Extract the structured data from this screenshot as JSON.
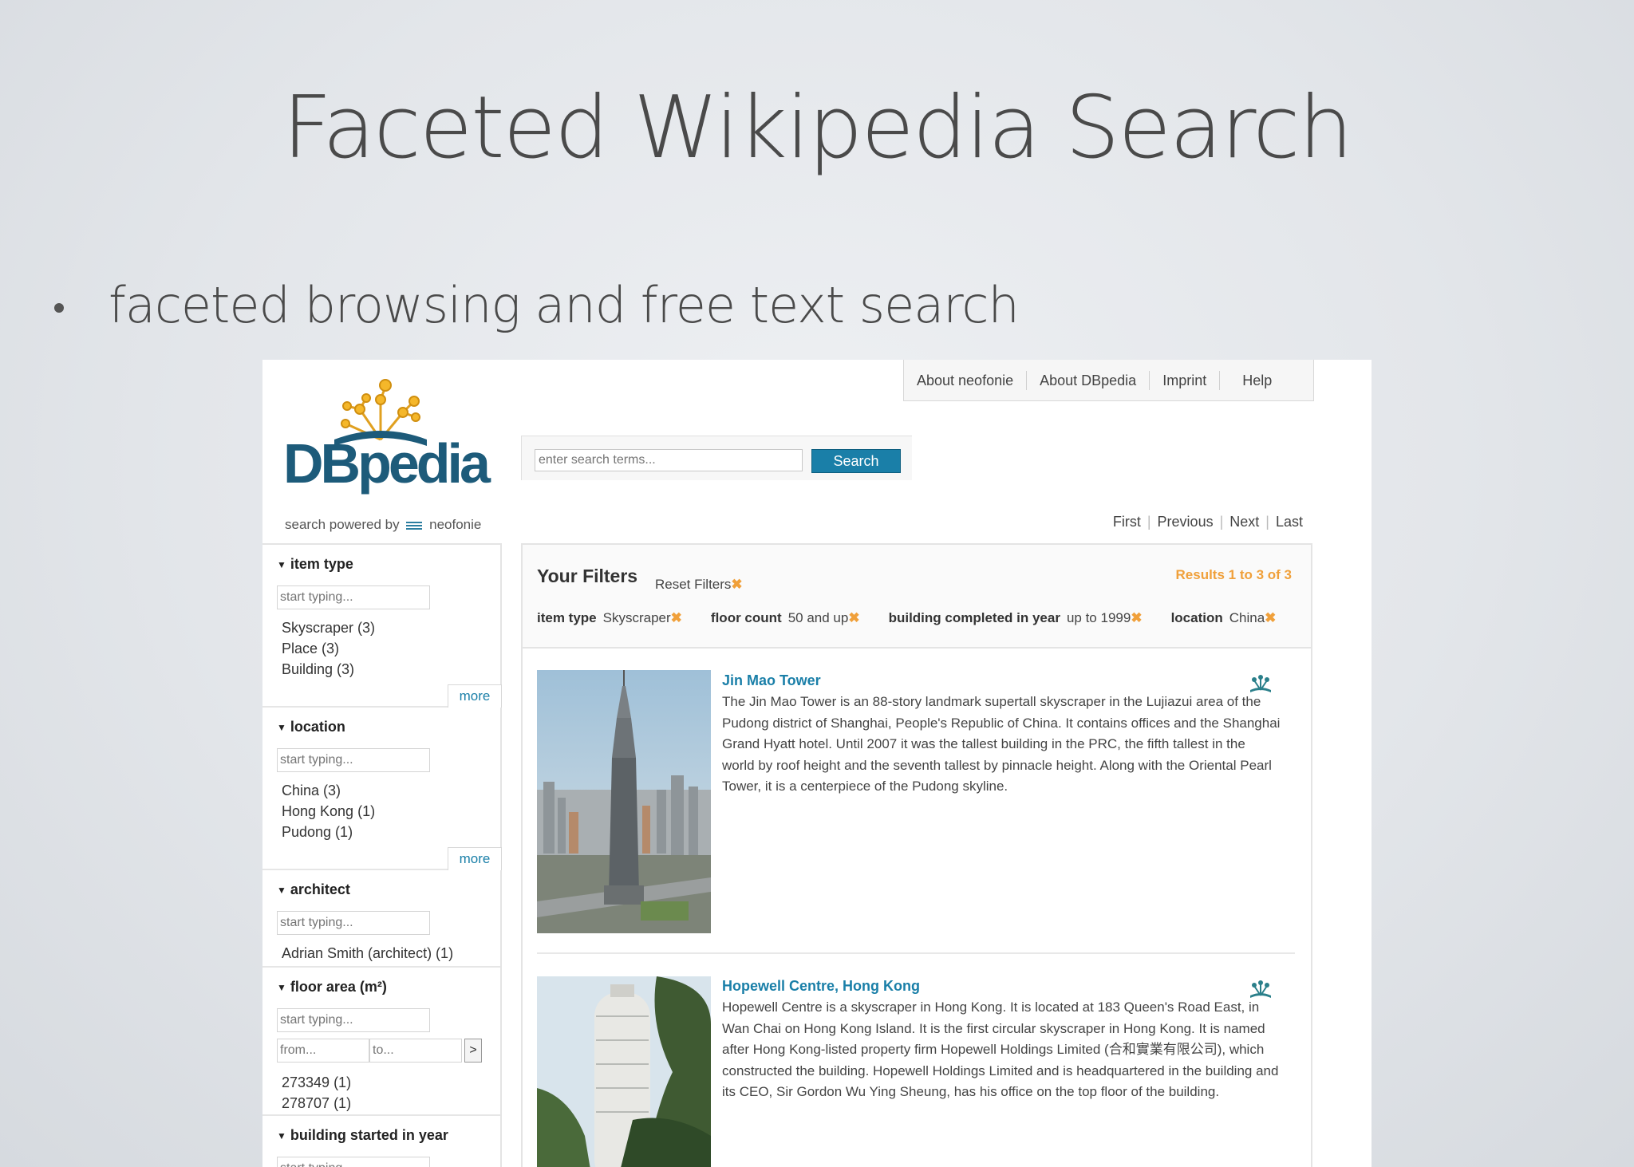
{
  "slide": {
    "title": "Faceted Wikipedia Search",
    "bullet": "faceted browsing and free text search"
  },
  "nav": {
    "links": [
      "About neofonie",
      "About DBpedia",
      "Imprint",
      "Help"
    ]
  },
  "logo": {
    "word": "DBpedia",
    "powered_by": "search powered by",
    "brand": "neofonie"
  },
  "search": {
    "placeholder": "enter search terms...",
    "button": "Search"
  },
  "pager": {
    "first": "First",
    "previous": "Previous",
    "next": "Next",
    "last": "Last"
  },
  "facets": {
    "item_type": {
      "title": "item type",
      "placeholder": "start typing...",
      "items": [
        "Skyscraper (3)",
        "Place (3)",
        "Building (3)"
      ],
      "more": "more"
    },
    "location": {
      "title": "location",
      "placeholder": "start typing...",
      "items": [
        "China (3)",
        "Hong Kong (1)",
        "Pudong (1)"
      ],
      "more": "more"
    },
    "architect": {
      "title": "architect",
      "placeholder": "start typing...",
      "items": [
        "Adrian Smith (architect) (1)"
      ]
    },
    "floor_area": {
      "title": "floor area (m²)",
      "placeholder": "start typing...",
      "from": "from...",
      "to": "to...",
      "go": ">",
      "items": [
        "273349 (1)",
        "278707 (1)"
      ]
    },
    "building_started": {
      "title": "building started in year",
      "placeholder": "start typing..."
    }
  },
  "filters": {
    "title": "Your Filters",
    "reset": "Reset Filters",
    "x": "✖",
    "results": "Results 1 to 3 of 3",
    "active": [
      {
        "label": "item type",
        "value": "Skyscraper"
      },
      {
        "label": "floor count",
        "value": "50 and up"
      },
      {
        "label": "building completed in year",
        "value": "up to 1999"
      },
      {
        "label": "location",
        "value": "China"
      }
    ]
  },
  "results": [
    {
      "title": "Jin Mao Tower",
      "text": "The Jin Mao Tower is an 88-story landmark supertall skyscraper in the Lujiazui area of the Pudong district of Shanghai, People's Republic of China. It contains offices and the Shanghai Grand Hyatt hotel. Until 2007 it was the tallest building in the PRC, the fifth tallest in the world by roof height and the seventh tallest by pinnacle height. Along with the Oriental Pearl Tower, it is a centerpiece of the Pudong skyline."
    },
    {
      "title": "Hopewell Centre, Hong Kong",
      "text": "Hopewell Centre is a skyscraper in Hong Kong. It is located at 183 Queen's Road East, in Wan Chai on Hong Kong Island. It is the first circular skyscraper in Hong Kong. It is named after Hong Kong-listed property firm Hopewell Holdings Limited (合和實業有限公司), which constructed the building. Hopewell Holdings Limited and is headquartered in the building and its CEO, Sir Gordon Wu Ying Sheung, has his office on the top floor of the building."
    }
  ],
  "colors": {
    "accent": "#1a7fa8",
    "filter_x": "#f0a03a",
    "logo": "#1d5b7a"
  }
}
